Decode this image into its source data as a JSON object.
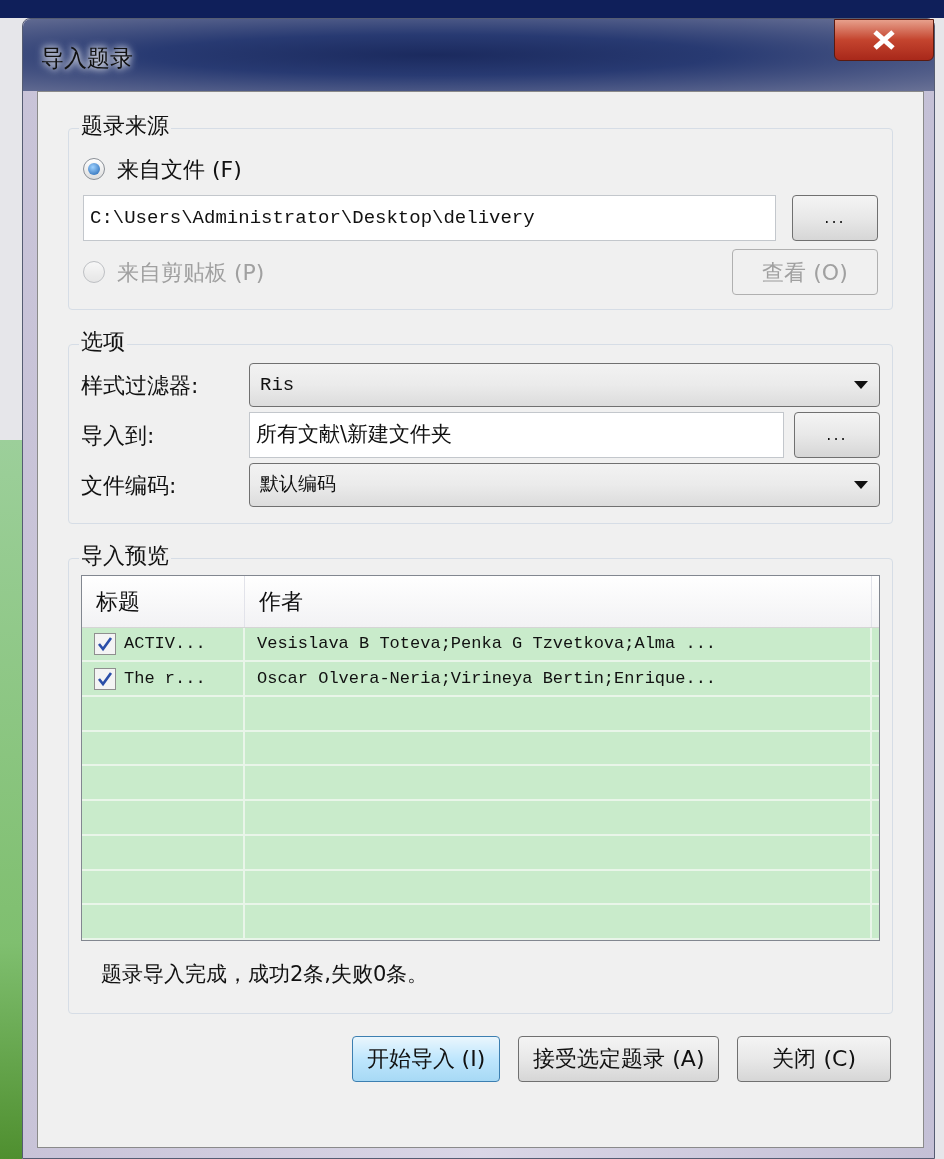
{
  "window": {
    "title": "导入题录"
  },
  "source": {
    "title": "题录来源",
    "options": [
      {
        "label": "来自文件 (F)",
        "selected": true,
        "disabled": false
      },
      {
        "label": "来自剪贴板 (P)",
        "selected": false,
        "disabled": true
      }
    ],
    "file_path": "C:\\Users\\Administrator\\Desktop\\delivery",
    "browse_button": "...",
    "view_button": {
      "label": "查看 (O)",
      "disabled": true
    }
  },
  "options": {
    "title": "选项",
    "fields": [
      {
        "kind": "select",
        "label": "样式过滤器:",
        "value": "Ris"
      },
      {
        "kind": "browse",
        "label": "导入到:",
        "value": "所有文献\\新建文件夹",
        "button": "..."
      },
      {
        "kind": "select",
        "label": "文件编码:",
        "value": "默认编码"
      }
    ]
  },
  "preview": {
    "title": "导入预览",
    "table": {
      "columns": [
        "标题",
        "作者"
      ],
      "rows": [
        {
          "checked": true,
          "title": "ACTIV...",
          "authors": "Vesislava B Toteva;Penka G Tzvetkova;Alma ..."
        },
        {
          "checked": true,
          "title": "The r...",
          "authors": "Oscar Olvera-Neria;Virineya Bertin;Enrique..."
        }
      ]
    },
    "status": "题录导入完成，成功2条,失败0条。"
  },
  "buttons": [
    {
      "label": "开始导入 (I)",
      "default": true
    },
    {
      "label": "接受选定题录 (A)",
      "default": false
    },
    {
      "label": "关闭 (C)",
      "default": false
    }
  ]
}
